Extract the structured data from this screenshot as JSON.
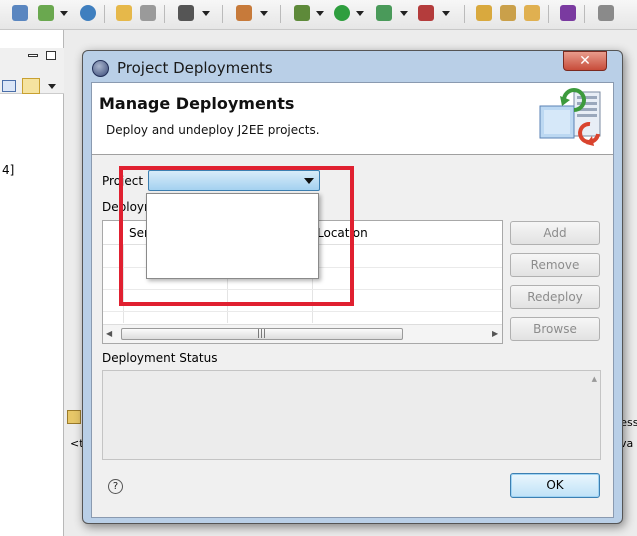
{
  "dialog": {
    "title": "Project Deployments",
    "close_label": "✕",
    "header_title": "Manage Deployments",
    "header_description": "Deploy and undeploy J2EE projects.",
    "project_label": "Project",
    "project_value": "",
    "project_options": [],
    "deployments_label": "Deploym",
    "table": {
      "columns": [
        "Ser",
        "Location"
      ],
      "rows": [],
      "scroll_grip": "|||"
    },
    "buttons": {
      "add": "Add",
      "remove": "Remove",
      "redeploy": "Redeploy",
      "browse": "Browse",
      "ok": "OK"
    },
    "deployment_status_label": "Deployment Status",
    "deployment_status_text": "",
    "help_label": "?"
  },
  "ide": {
    "left_panel_text": "4]",
    "right_tab_text": "ress",
    "right_tab_text2": "va",
    "bottom_tab_text": "<t"
  },
  "colors": {
    "highlight": "#e02030",
    "combo_fill": "#a4d1f0",
    "dialog_frame": "#b9cfe7",
    "close_button": "#c74c3a"
  },
  "icons": [
    "dialog-app-icon",
    "close-icon",
    "server-deploy-icon",
    "dropdown-arrow-icon",
    "help-icon",
    "scroll-left-icon",
    "scroll-right-icon"
  ]
}
